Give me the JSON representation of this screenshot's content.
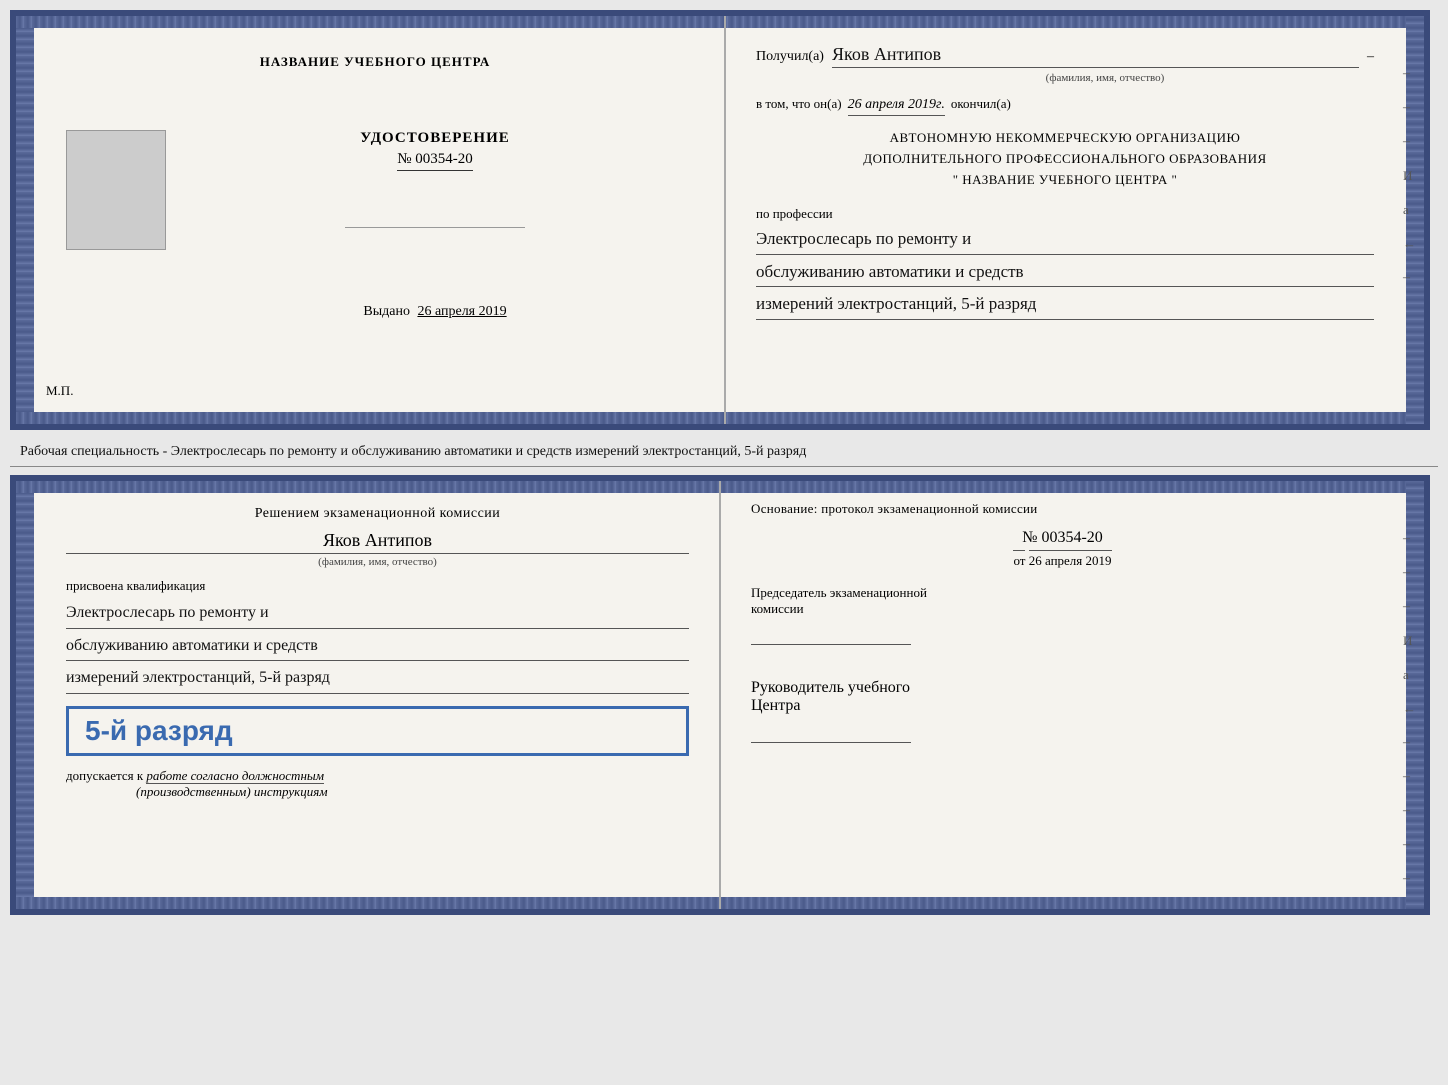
{
  "top_cert": {
    "left": {
      "org_name": "НАЗВАНИЕ УЧЕБНОГО ЦЕНТРА",
      "udostoverenie_label": "УДОСТОВЕРЕНИЕ",
      "number": "№ 00354-20",
      "vydano_label": "Выдано",
      "vydano_date": "26 апреля 2019",
      "mp_label": "М.П."
    },
    "right": {
      "poluchil_label": "Получил(а)",
      "recipient_name": "Яков Антипов",
      "fio_subtext": "(фамилия, имя, отчество)",
      "vtom_label": "в том, что он(а)",
      "vtom_date": "26 апреля 2019г.",
      "okonchil_label": "окончил(а)",
      "org_line1": "АВТОНОМНУЮ НЕКОММЕРЧЕСКУЮ ОРГАНИЗАЦИЮ",
      "org_line2": "ДОПОЛНИТЕЛЬНОГО ПРОФЕССИОНАЛЬНОГО ОБРАЗОВАНИЯ",
      "org_line3": "\" НАЗВАНИЕ УЧЕБНОГО ЦЕНТРА \"",
      "po_professii_label": "по профессии",
      "profession_line1": "Электрослесарь по ремонту и",
      "profession_line2": "обслуживанию автоматики и средств",
      "profession_line3": "измерений электростанций, 5-й разряд"
    }
  },
  "between_text": "Рабочая специальность - Электрослесарь по ремонту и обслуживанию автоматики и средств измерений электростанций, 5-й разряд",
  "bottom_cert": {
    "left": {
      "resheniem_label": "Решением экзаменационной комиссии",
      "fio_name": "Яков Антипов",
      "fio_subtext": "(фамилия, имя, отчество)",
      "prisvoena_label": "присвоена квалификация",
      "profession_line1": "Электрослесарь по ремонту и",
      "profession_line2": "обслуживанию автоматики и средств",
      "profession_line3": "измерений электростанций, 5-й разряд",
      "rank_badge": "5-й разряд",
      "dopuskaetsya_label": "допускается к",
      "dopuskaetsya_text": "работе согласно должностным",
      "instruktsii_text": "(производственным) инструкциям"
    },
    "right": {
      "osnovanie_label": "Основание: протокол экзаменационной комиссии",
      "protocol_number": "№ 00354-20",
      "ot_label": "от",
      "ot_date": "26 апреля 2019",
      "predsedatel_label": "Председатель экзаменационной",
      "predsedatel_label2": "комиссии",
      "rukovoditel_label": "Руководитель учебного",
      "rukovoditel_label2": "Центра"
    },
    "right_marks": [
      "–",
      "–",
      "–",
      "И",
      "а",
      "←",
      "–",
      "–",
      "–",
      "–",
      "–"
    ]
  }
}
